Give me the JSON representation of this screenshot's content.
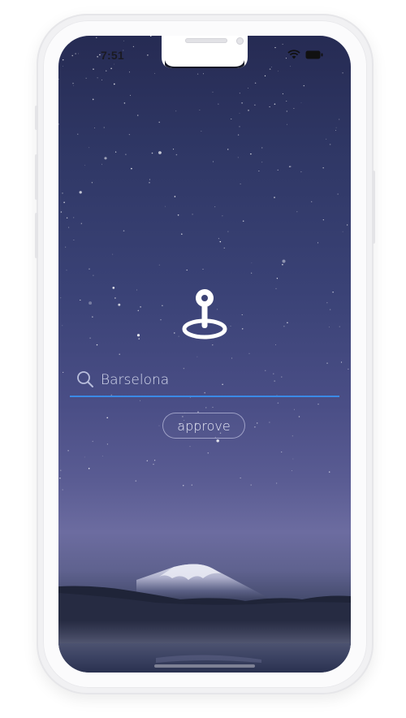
{
  "status_bar": {
    "time": "7:51",
    "wifi_icon": "wifi-icon",
    "battery_icon": "battery-icon"
  },
  "hero": {
    "icon": "location-pin-icon"
  },
  "search": {
    "icon": "search-icon",
    "value": "Barselona",
    "placeholder": ""
  },
  "actions": {
    "approve_label": "approve"
  },
  "colors": {
    "accent": "#3a8ae6",
    "text": "#d8dcf0",
    "sky_top": "#262b53",
    "sky_bottom": "#6c6ca0"
  }
}
